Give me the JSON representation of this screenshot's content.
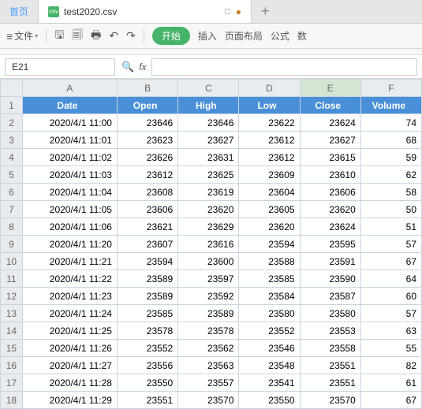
{
  "tabs": {
    "home": "首页",
    "file_icon": "csv",
    "filename": "test2020.csv",
    "new": "+"
  },
  "toolbar": {
    "file_menu": "文件",
    "start": "开始",
    "insert": "插入",
    "page_layout": "页面布局",
    "formula": "公式",
    "data": "数"
  },
  "formula_bar": {
    "namebox": "E21",
    "fx": "fx",
    "value": ""
  },
  "columns": [
    "A",
    "B",
    "C",
    "D",
    "E",
    "F"
  ],
  "active_column": "E",
  "headers": [
    "Date",
    "Open",
    "High",
    "Low",
    "Close",
    "Volume"
  ],
  "rows": [
    [
      "2020/4/1 11:00",
      "23646",
      "23646",
      "23622",
      "23624",
      "74"
    ],
    [
      "2020/4/1 11:01",
      "23623",
      "23627",
      "23612",
      "23627",
      "68"
    ],
    [
      "2020/4/1 11:02",
      "23626",
      "23631",
      "23612",
      "23615",
      "59"
    ],
    [
      "2020/4/1 11:03",
      "23612",
      "23625",
      "23609",
      "23610",
      "62"
    ],
    [
      "2020/4/1 11:04",
      "23608",
      "23619",
      "23604",
      "23606",
      "58"
    ],
    [
      "2020/4/1 11:05",
      "23606",
      "23620",
      "23605",
      "23620",
      "50"
    ],
    [
      "2020/4/1 11:06",
      "23621",
      "23629",
      "23620",
      "23624",
      "51"
    ],
    [
      "2020/4/1 11:20",
      "23607",
      "23616",
      "23594",
      "23595",
      "57"
    ],
    [
      "2020/4/1 11:21",
      "23594",
      "23600",
      "23588",
      "23591",
      "67"
    ],
    [
      "2020/4/1 11:22",
      "23589",
      "23597",
      "23585",
      "23590",
      "64"
    ],
    [
      "2020/4/1 11:23",
      "23589",
      "23592",
      "23584",
      "23587",
      "60"
    ],
    [
      "2020/4/1 11:24",
      "23585",
      "23589",
      "23580",
      "23580",
      "57"
    ],
    [
      "2020/4/1 11:25",
      "23578",
      "23578",
      "23552",
      "23553",
      "63"
    ],
    [
      "2020/4/1 11:26",
      "23552",
      "23562",
      "23546",
      "23558",
      "55"
    ],
    [
      "2020/4/1 11:27",
      "23556",
      "23563",
      "23548",
      "23551",
      "82"
    ],
    [
      "2020/4/1 11:28",
      "23550",
      "23557",
      "23541",
      "23551",
      "61"
    ],
    [
      "2020/4/1 11:29",
      "23551",
      "23570",
      "23550",
      "23570",
      "67"
    ]
  ]
}
